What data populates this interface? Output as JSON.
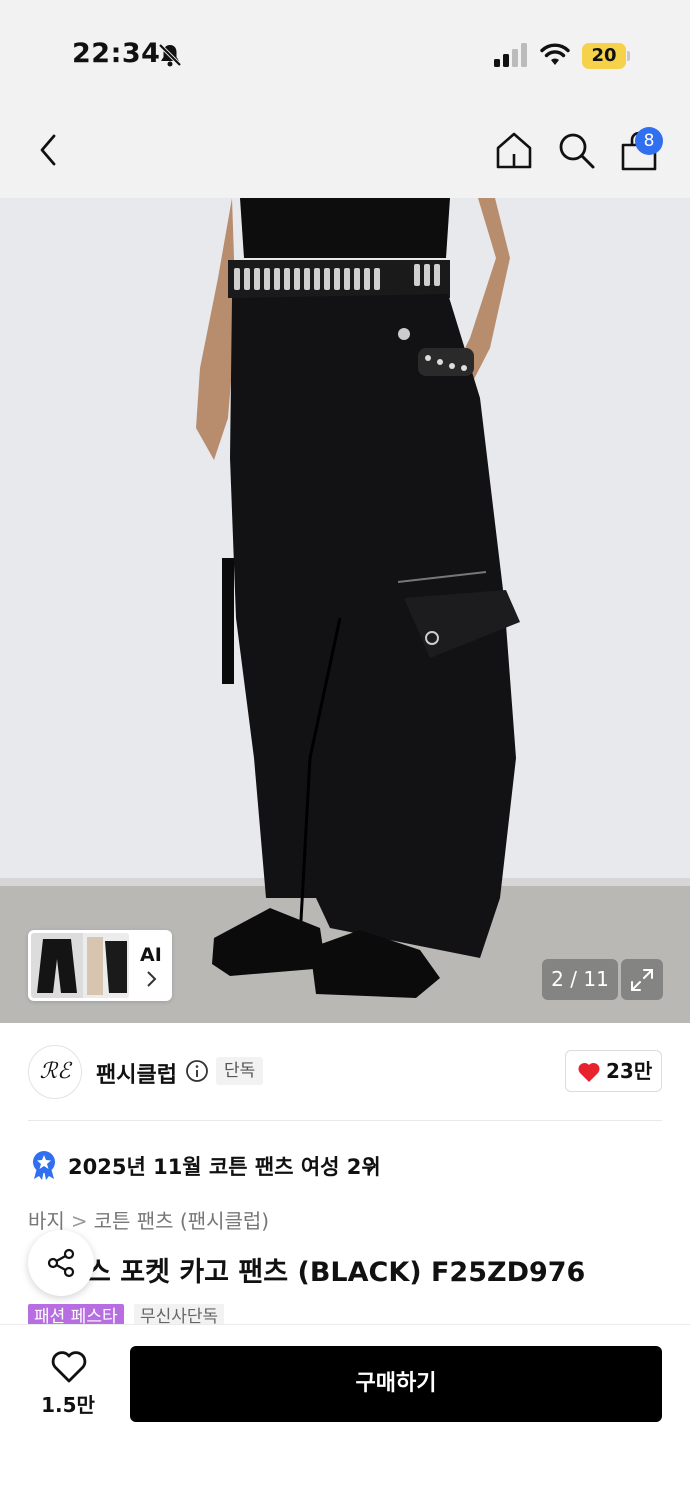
{
  "status_bar": {
    "time": "22:34",
    "battery_level": "20"
  },
  "nav": {
    "cart_count": "8"
  },
  "gallery": {
    "counter": "2 / 11",
    "ai_label": "AI"
  },
  "brand": {
    "logo_text": "ℛℰ",
    "name": "팬시클럽",
    "exclusive_badge": "단독",
    "like_count": "23만"
  },
  "ranking": {
    "text": "2025년 11월 코튼 팬츠 여성 2위"
  },
  "breadcrumb": {
    "category": "바지",
    "subcategory": "코튼 팬츠 (팬시클럽)"
  },
  "product": {
    "title": "스 포켓 카고 팬츠 (BLACK) F25ZD976",
    "tag_festa": "패션 페스타",
    "tag_exclusive": "무신사단독"
  },
  "bottom": {
    "wish_count": "1.5만",
    "buy_label": "구매하기"
  },
  "colors": {
    "badge_blue": "#2f6ff0",
    "heart_red": "#e8232e",
    "festa_purple": "#b76ee0",
    "battery_yellow": "#f5d24a"
  }
}
